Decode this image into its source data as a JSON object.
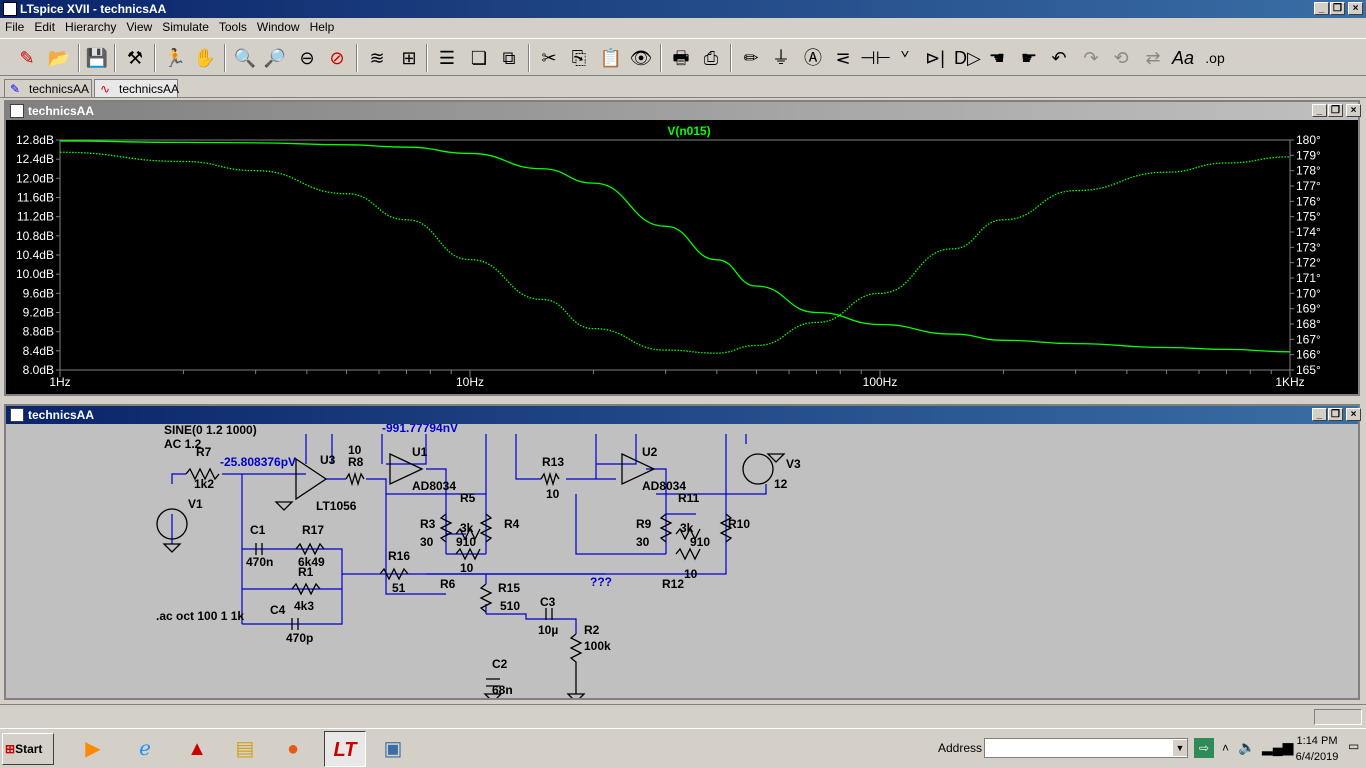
{
  "window": {
    "title": "LTspice XVII - technicsAA"
  },
  "menu": [
    "File",
    "Edit",
    "Hierarchy",
    "View",
    "Simulate",
    "Tools",
    "Window",
    "Help"
  ],
  "toolbar": [
    "new-schematic-icon",
    "open-icon",
    "save-icon",
    "control-panel-icon",
    "run-icon",
    "halt-icon",
    "zoom-in-icon",
    "zoom-pan-icon",
    "zoom-out-icon",
    "zoom-cancel-icon",
    "autorange-icon",
    "manual-limits-icon",
    "tile-horizontal-icon",
    "cascade-icon",
    "tile-vertical-icon",
    "cut-icon",
    "copy-icon",
    "paste-icon",
    "find-icon",
    "print-icon",
    "print-setup-icon",
    "draw-wire-icon",
    "ground-icon",
    "label-net-icon",
    "resistor-icon",
    "capacitor-icon",
    "inductor-icon",
    "diode-icon",
    "component-icon",
    "move-icon",
    "drag-icon",
    "undo-icon",
    "redo-icon",
    "rotate-icon",
    "mirror-icon",
    "text-icon",
    "spice-directive-icon"
  ],
  "tabs": [
    {
      "label": "technicsAA"
    },
    {
      "label": "technicsAA"
    }
  ],
  "plot": {
    "title": "technicsAA",
    "trace_label": "V(n015)",
    "trace_color": "#00ff00",
    "left_ticks": [
      "12.8dB",
      "12.4dB",
      "12.0dB",
      "11.6dB",
      "11.2dB",
      "10.8dB",
      "10.4dB",
      "10.0dB",
      "9.6dB",
      "9.2dB",
      "8.8dB",
      "8.4dB",
      "8.0dB"
    ],
    "right_ticks": [
      "180°",
      "179°",
      "178°",
      "177°",
      "176°",
      "175°",
      "174°",
      "173°",
      "172°",
      "171°",
      "170°",
      "169°",
      "168°",
      "167°",
      "166°",
      "165°"
    ],
    "x_ticks": [
      "1Hz",
      "10Hz",
      "100Hz",
      "1KHz"
    ]
  },
  "chart_data": {
    "type": "line",
    "xscale": "log",
    "x": [
      1,
      2,
      3,
      5,
      7,
      10,
      15,
      20,
      30,
      40,
      50,
      70,
      100,
      150,
      200,
      300,
      500,
      700,
      1000
    ],
    "series": [
      {
        "name": "V(n015)",
        "axis": "magnitude",
        "unit": "dB",
        "values": [
          12.78,
          12.75,
          12.74,
          12.7,
          12.65,
          12.52,
          12.2,
          11.9,
          11.0,
          10.3,
          9.75,
          9.2,
          8.95,
          8.75,
          8.62,
          8.55,
          8.47,
          8.43,
          8.38
        ]
      },
      {
        "name": "V(n015)",
        "axis": "phase",
        "unit": "°",
        "values": [
          179.2,
          178.6,
          178.0,
          176.5,
          174.8,
          172.2,
          169.6,
          167.7,
          166.3,
          166.1,
          166.6,
          168.1,
          170.0,
          172.9,
          174.8,
          176.7,
          177.9,
          178.5,
          178.9
        ]
      }
    ],
    "xlim": [
      1,
      1000
    ],
    "ylim_left": [
      8.0,
      12.8
    ],
    "ylim_right": [
      165,
      180
    ]
  },
  "schematic": {
    "title": "technicsAA",
    "labels": {
      "sine": "SINE(0 1.2 1000)",
      "ac": "AC 1.2",
      "r7": "R7",
      "r7v": "1k2",
      "v1": "V1",
      "node1": "-25.808376pV",
      "u3": "U3",
      "lt1056": "LT1056",
      "r8": "R8",
      "r8v": "10",
      "u1": "U1",
      "ad8034a": "AD8034",
      "node2": "-991.77794nV",
      "c1": "C1",
      "c1v": "470n",
      "r17": "R17",
      "r17v": "6k49",
      "r1": "R1",
      "r1v": "4k3",
      "c4": "C4",
      "c4v": "470p",
      "ac_dir": ".ac oct 100 1 1k",
      "r16": "R16",
      "r16v": "51",
      "r5": "R5",
      "r5v": "3k",
      "r3": "R3",
      "r3v": "30",
      "r4": "R4",
      "r4v": "910",
      "r6": "R6",
      "r6v": "10",
      "r15": "R15",
      "r15v": "510",
      "c3": "C3",
      "c3v": "10µ",
      "r2": "R2",
      "r2v": "100k",
      "c2": "C2",
      "c2v": "68n",
      "r13": "R13",
      "r13v": "10",
      "u2": "U2",
      "ad8034b": "AD8034",
      "r11": "R11",
      "r11v": "3k",
      "r9": "R9",
      "r9v": "30",
      "r10": "R10",
      "r10v": "910",
      "r12": "R12",
      "r12v": "10",
      "v3": "V3",
      "v3v": "12",
      "qqq": "???"
    }
  },
  "taskbar": {
    "start": "Start",
    "address_label": "Address",
    "time": "1:14 PM",
    "date": "6/4/2019"
  }
}
